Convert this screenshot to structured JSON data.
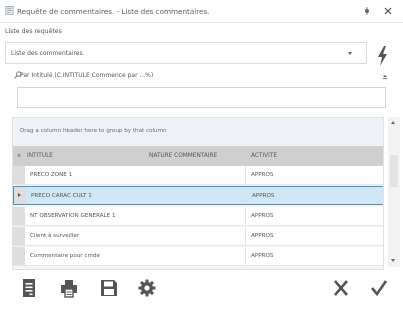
{
  "window": {
    "title": "Requête de commentaires. - Liste des commentaires."
  },
  "filters": {
    "list_label": "Liste des requêtes",
    "selected_list": "Liste des commentaires.",
    "search_label": "Par Intitulé (C.INTITULE Commence par ...%)",
    "search_value": ""
  },
  "grid": {
    "group_hint": "Drag a column header here to group by that column",
    "columns": [
      "INTITULE",
      "NATURE COMMENTAIRE",
      "ACTIVITE"
    ],
    "rows": [
      {
        "intitule": "PRECO ZONE 1",
        "nature": "",
        "activite": "APPROS"
      },
      {
        "intitule": "PRECO CARAC CULT 1",
        "nature": "",
        "activite": "APPROS"
      },
      {
        "intitule": "NT OBSERVATION GENERALE 1",
        "nature": "",
        "activite": "APPROS"
      },
      {
        "intitule": "Client à surveiller",
        "nature": "",
        "activite": "APPROS"
      },
      {
        "intitule": "Commentaire pour cmde",
        "nature": "",
        "activite": "APPROS"
      }
    ]
  },
  "colors": {
    "selected_row": "#cfe7f5",
    "selected_border": "#4e8fbe",
    "header_bg": "#cfcfcf",
    "icon_dark": "#555555"
  },
  "icons": {
    "title": "document-icon",
    "pin": "pin-icon",
    "close": "close-icon",
    "execute": "lightning-icon",
    "search": "search-icon",
    "collapse": "chevron-up-icon",
    "sheet": "sheet-icon",
    "print": "printer-icon",
    "save": "save-icon",
    "settings": "gear-icon",
    "cancel": "cancel-icon",
    "validate": "check-icon"
  }
}
